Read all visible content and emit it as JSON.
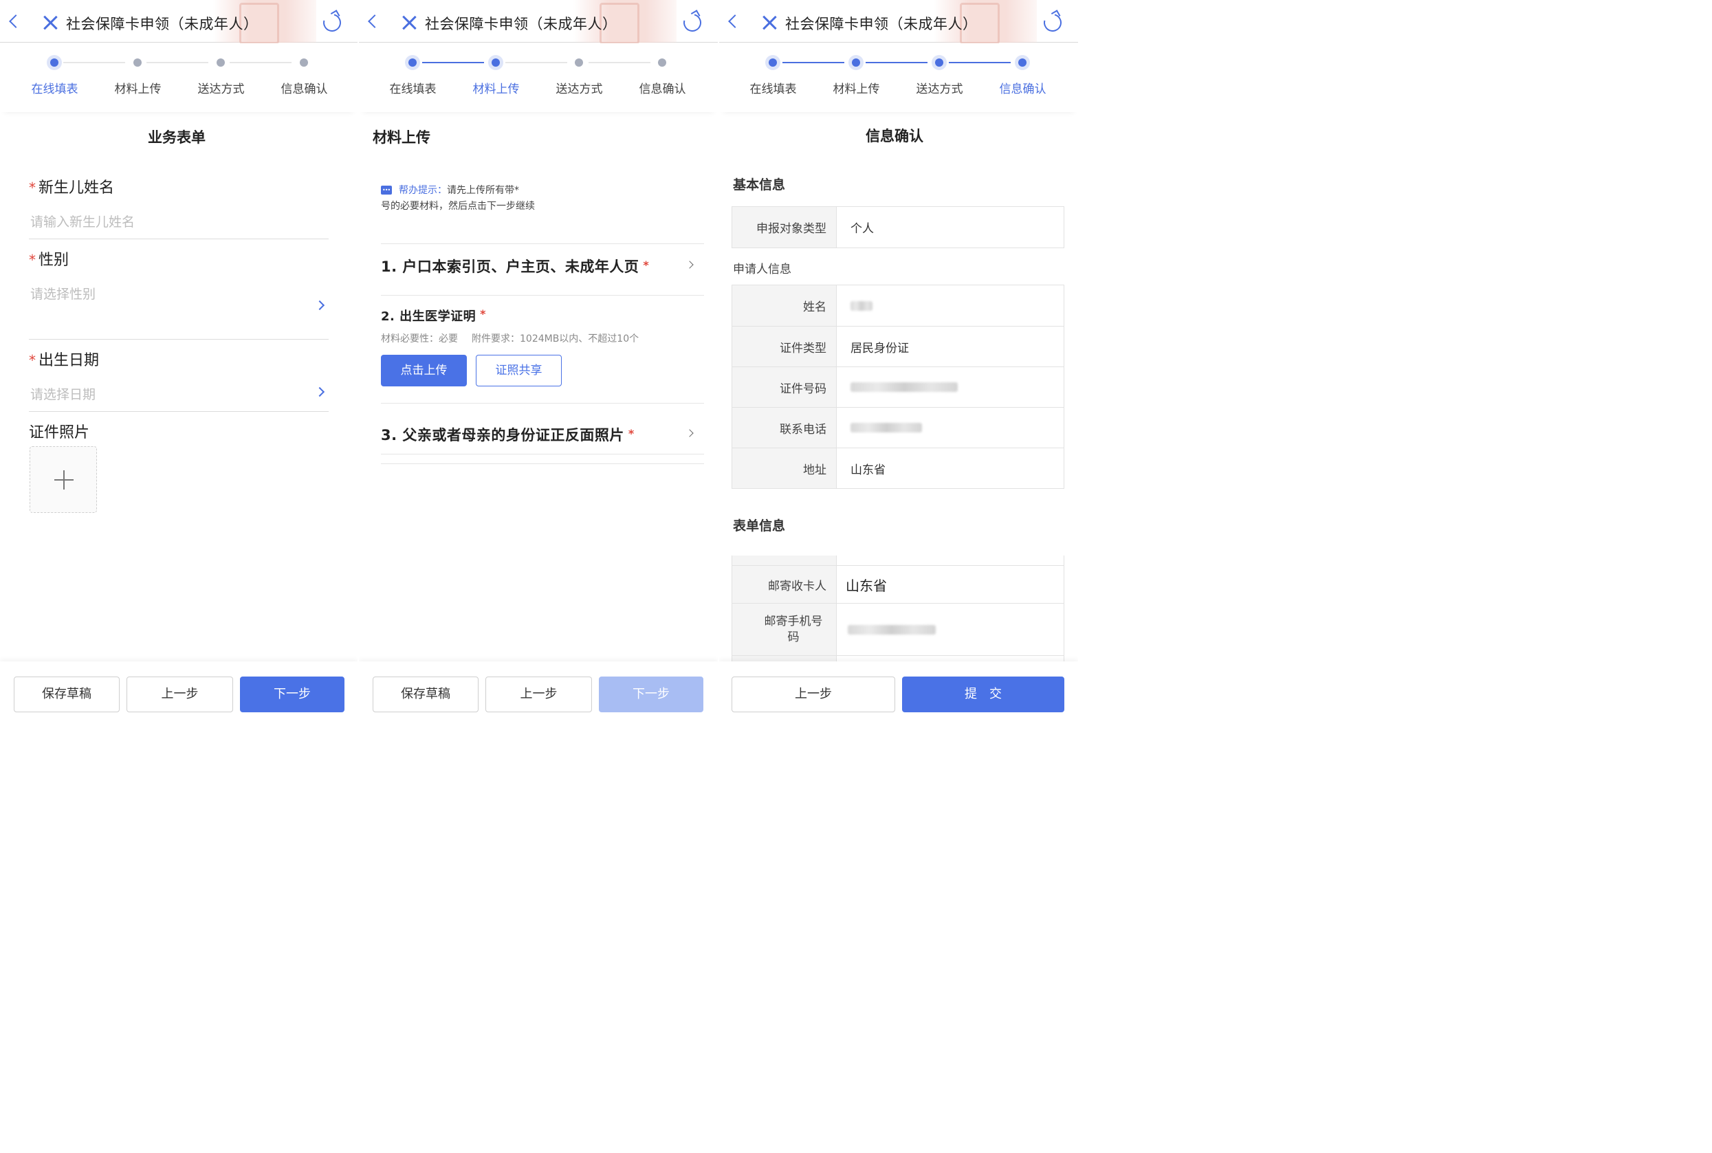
{
  "screens": [
    {
      "header": {
        "title": "社会保障卡申领（未成年人）"
      },
      "steps": [
        "在线填表",
        "材料上传",
        "送达方式",
        "信息确认"
      ],
      "section_title": "业务表单",
      "fields": [
        {
          "label": "新生儿姓名",
          "placeholder": "请输入新生儿姓名",
          "required": true
        },
        {
          "label": "性别",
          "placeholder": "请选择性别",
          "required": true
        },
        {
          "label": "出生日期",
          "placeholder": "请选择日期",
          "required": true
        },
        {
          "label": "证件照片",
          "required": false
        }
      ],
      "buttons": {
        "draft": "保存草稿",
        "prev": "上一步",
        "next": "下一步"
      }
    },
    {
      "header": {
        "title": "社会保障卡申领（未成年人）"
      },
      "steps": [
        "在线填表",
        "材料上传",
        "送达方式",
        "信息确认"
      ],
      "section_title": "材料上传",
      "tip": {
        "label": "帮办提示：",
        "text": "请先上传所有带*",
        "text2": "号的必要材料，然后点击下一步继续"
      },
      "materials": [
        {
          "title": "1. 户口本索引页、户主页、未成年人页",
          "star": "*"
        },
        {
          "title": "2. 出生医学证明",
          "star": "*",
          "necessity": "材料必要性：必要",
          "requirement": "附件要求：1024MB以内、不超过10个",
          "upload": "点击上传",
          "share": "证照共享"
        },
        {
          "title": "3. 父亲或者母亲的身份证正反面照片",
          "star": "*"
        }
      ],
      "buttons": {
        "draft": "保存草稿",
        "prev": "上一步",
        "next": "下一步"
      }
    },
    {
      "header": {
        "title": "社会保障卡申领（未成年人）"
      },
      "steps": [
        "在线填表",
        "材料上传",
        "送达方式",
        "信息确认"
      ],
      "section_title": "信息确认",
      "basic_title": "基本信息",
      "basic": [
        {
          "k": "申报对象类型",
          "v": "个人"
        }
      ],
      "applicant_title": "申请人信息",
      "applicant": [
        {
          "k": "姓名",
          "v": ""
        },
        {
          "k": "证件类型",
          "v": "居民身份证"
        },
        {
          "k": "证件号码",
          "v": ""
        },
        {
          "k": "联系电话",
          "v": ""
        },
        {
          "k": "地址",
          "v": "山东省"
        }
      ],
      "form_title": "表单信息",
      "form": [
        {
          "k": "邮寄收卡人",
          "v": "山东省"
        },
        {
          "k": "邮寄手机号码",
          "v": ""
        }
      ],
      "buttons": {
        "prev": "上一步",
        "submit": "提　交"
      }
    }
  ],
  "colors": {
    "accent": "#4a72e6",
    "required": "#e0463b",
    "disabled": "#a8bdf3"
  },
  "icons": [
    "back-icon",
    "close-icon",
    "refresh-icon",
    "chevron-right-icon",
    "plus-icon",
    "message-icon"
  ]
}
